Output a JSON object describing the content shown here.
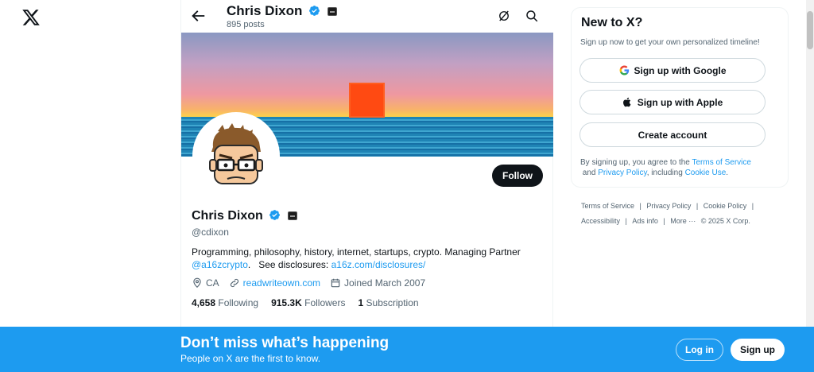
{
  "header": {
    "name": "Chris Dixon",
    "posts": "895 posts"
  },
  "profile": {
    "name": "Chris Dixon",
    "handle": "@cdixon",
    "follow_label": "Follow",
    "bio_text": "Programming, philosophy, history, internet, startups, crypto. Managing Partner",
    "bio_mention": "@a16zcrypto",
    "bio_disclosures_prefix": ".   See disclosures: ",
    "bio_link": "a16z.com/disclosures/",
    "location": "CA",
    "website": "readwriteown.com",
    "joined": "Joined March 2007",
    "following_count": "4,658",
    "following_label": "Following",
    "followers_count": "915.3K",
    "followers_label": "Followers",
    "subscription_count": "1",
    "subscription_label": "Subscription"
  },
  "sidebar": {
    "title": "New to X?",
    "subtitle": "Sign up now to get your own personalized timeline!",
    "google_label": "Sign up with Google",
    "apple_label": "Sign up with Apple",
    "create_label": "Create account",
    "terms_prefix": "By signing up, you agree to the ",
    "terms_link": "Terms of Service",
    "terms_and": " and ",
    "privacy_link": "Privacy Policy",
    "terms_including": ", including ",
    "cookie_link": "Cookie Use",
    "terms_end": "."
  },
  "footer_links": {
    "terms": "Terms of Service",
    "privacy": "Privacy Policy",
    "cookie": "Cookie Policy",
    "accessibility": "Accessibility",
    "ads": "Ads info",
    "more": "More ···",
    "copyright": "© 2025 X Corp."
  },
  "bottom_bar": {
    "title": "Don’t miss what’s happening",
    "subtitle": "People on X are the first to know.",
    "login_label": "Log in",
    "signup_label": "Sign up"
  },
  "colors": {
    "accent": "#1d9bf0",
    "text": "#0f1419",
    "muted": "#536471"
  }
}
